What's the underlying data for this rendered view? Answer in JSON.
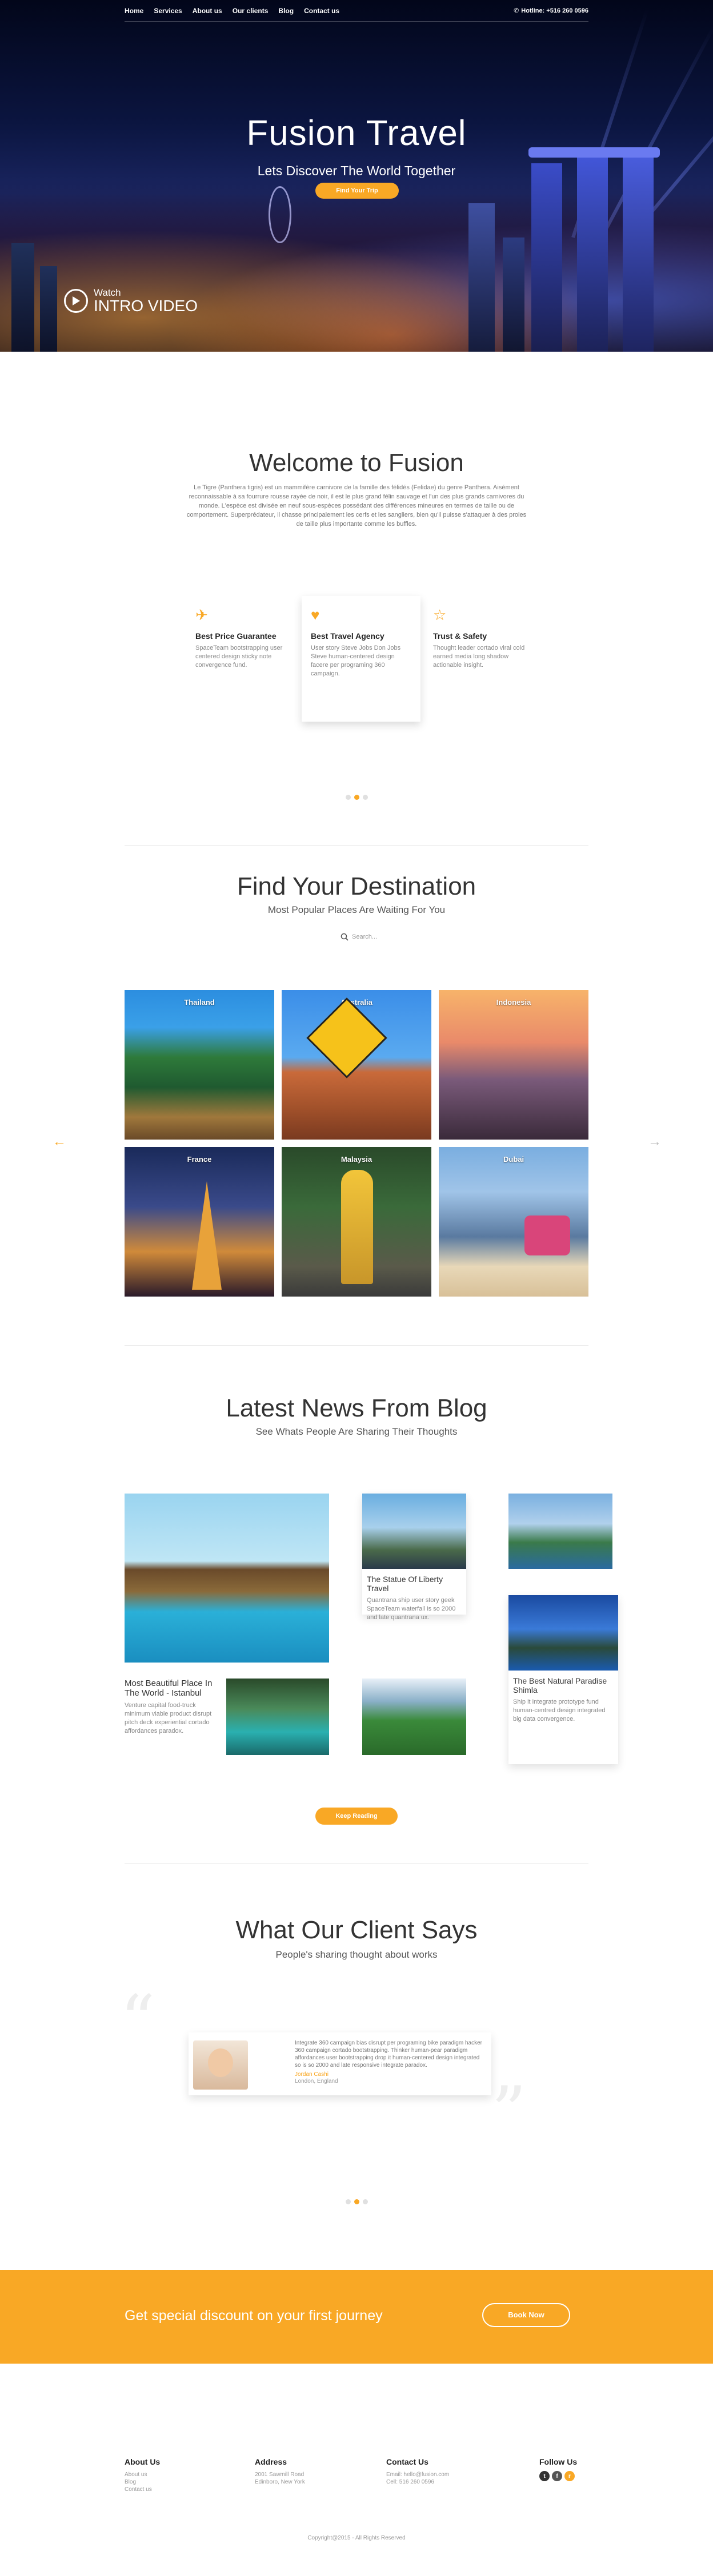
{
  "nav": {
    "items": [
      "Home",
      "Services",
      "About us",
      "Our clients",
      "Blog",
      "Contact us"
    ],
    "hotline": "Hotline: +516 260 0596"
  },
  "hero": {
    "title": "Fusion Travel",
    "subtitle": "Lets Discover The World Together",
    "button": "Find Your Trip",
    "watch": "Watch",
    "intro": "INTRO VIDEO"
  },
  "welcome": {
    "title": "Welcome to Fusion",
    "text": "Le Tigre (Panthera tigris) est un mammifère carnivore de la famille des félidés (Felidae) du genre Panthera. Aisément reconnaissable à sa fourrure rousse rayée de noir, il est le plus grand félin sauvage et l'un des plus grands carnivores du monde. L'espèce est divisée en neuf sous-espèces possédant des différences mineures en termes de taille ou de comportement. Superprédateur, il chasse principalement les cerfs et les sangliers, bien qu'il puisse s'attaquer à des proies de taille plus importante comme les buffles."
  },
  "features": [
    {
      "icon": "plane-icon",
      "title": "Best Price Guarantee",
      "text": "SpaceTeam bootstrapping user centered design sticky note convergence fund."
    },
    {
      "icon": "heart-icon",
      "title": "Best Travel Agency",
      "text": "User story Steve Jobs Don Jobs Steve human-centered design facere per programing 360 campaign."
    },
    {
      "icon": "star-icon",
      "title": "Trust & Safety",
      "text": "Thought leader cortado viral cold earned media long shadow actionable insight."
    }
  ],
  "destination": {
    "title": "Find Your Destination",
    "subtitle": "Most Popular Places Are Waiting For You",
    "search_placeholder": "Search...",
    "items": [
      "Thailand",
      "Australia",
      "Indonesia",
      "France",
      "Malaysia",
      "Dubai"
    ]
  },
  "blog": {
    "title": "Latest News From Blog",
    "subtitle": "See Whats People Are Sharing Their Thoughts",
    "posts": [
      {
        "title": "The Statue Of Liberty Travel",
        "text": "Quantrana ship user story geek SpaceTeam waterfall is so 2000 and late quantrana ux."
      },
      {
        "title": "Most Beautiful Place In The World - Istanbul",
        "text": "Venture capital food-truck minimum viable product disrupt pitch deck experiential cortado affordances paradox."
      },
      {
        "title": "The Best Natural Paradise Shimla",
        "text": "Ship it integrate prototype fund human-centred design integrated big data convergence."
      }
    ],
    "button": "Keep Reading"
  },
  "testimonial": {
    "title": "What Our Client Says",
    "subtitle": "People's sharing thought about works",
    "text": "Integrate 360 campaign bias disrupt per programing bike paradigm hacker 360 campaign cortado bootstrapping. Thinker human-pear paradigm affordances user bootstrapping drop it human-centered design integrated so is so 2000 and late responsive integrate paradox.",
    "name": "Jordan Cashi",
    "location": "London, England"
  },
  "cta": {
    "text": "Get special discount on your first journey",
    "button": "Book Now"
  },
  "footer": {
    "about": {
      "title": "About Us",
      "lines": [
        "About us",
        "Blog",
        "Contact us"
      ]
    },
    "address": {
      "title": "Address",
      "lines": [
        "2001 Sawmill Road",
        "Edinboro, New York"
      ]
    },
    "contact": {
      "title": "Contact Us",
      "lines": [
        "Email: hello@fusion.com",
        "Cell: 516 260 0596"
      ]
    },
    "follow": {
      "title": "Follow Us"
    },
    "copyright": "Copyright@2015 - All Rights Reserved"
  },
  "colors": {
    "accent": "#f9a825"
  }
}
